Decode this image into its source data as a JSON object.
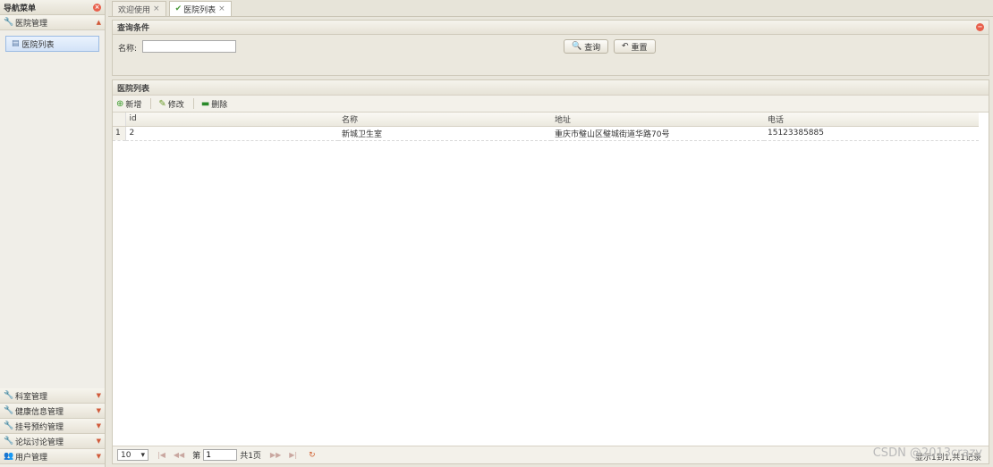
{
  "nav": {
    "title": "导航菜单",
    "groups": [
      {
        "label": "医院管理",
        "expanded": true,
        "items": [
          {
            "label": "医院列表"
          }
        ]
      },
      {
        "label": "科室管理"
      },
      {
        "label": "健康信息管理"
      },
      {
        "label": "挂号预约管理"
      },
      {
        "label": "论坛讨论管理"
      },
      {
        "label": "用户管理"
      }
    ]
  },
  "tabs": [
    {
      "label": "欢迎使用"
    },
    {
      "label": "医院列表"
    }
  ],
  "query": {
    "title": "查询条件",
    "name_label": "名称:",
    "name_value": "",
    "search_label": "查询",
    "reset_label": "重置"
  },
  "list": {
    "title": "医院列表",
    "toolbar": {
      "add": "新增",
      "edit": "修改",
      "delete": "删除"
    },
    "columns": [
      "id",
      "名称",
      "地址",
      "电话"
    ],
    "rows": [
      {
        "rownum": "1",
        "id": "2",
        "name": "新城卫生室",
        "address": "重庆市璧山区璧城街道华路70号",
        "phone": "15123385885"
      }
    ]
  },
  "pager": {
    "page_size": "10",
    "page_prefix": "第",
    "page_value": "1",
    "total_pages": "共1页",
    "info": "显示1到1,共1记录"
  },
  "watermark": "CSDN @2013crazy"
}
